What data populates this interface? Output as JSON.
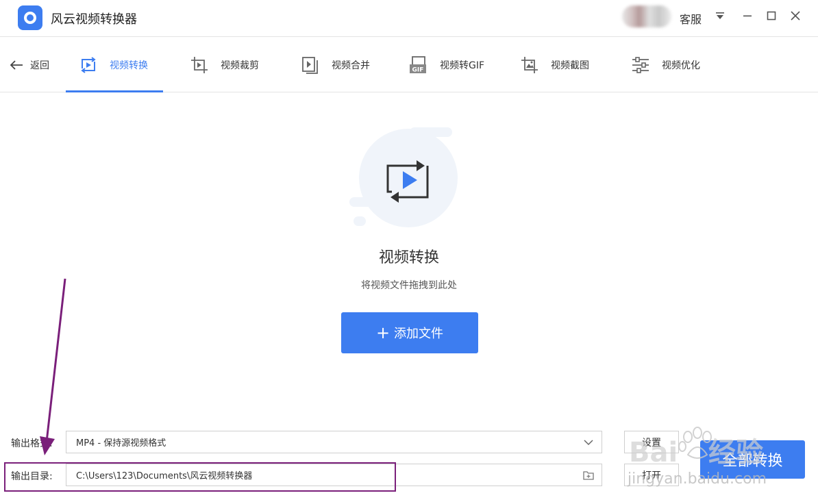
{
  "app": {
    "title": "风云视频转换器",
    "service_label": "客服"
  },
  "toolbar": {
    "back": "返回",
    "tabs": [
      {
        "label": "视频转换",
        "icon": "convert-icon",
        "active": true
      },
      {
        "label": "视频裁剪",
        "icon": "crop-icon",
        "active": false
      },
      {
        "label": "视频合并",
        "icon": "merge-icon",
        "active": false
      },
      {
        "label": "视频转GIF",
        "icon": "gif-icon",
        "active": false
      },
      {
        "label": "视频截图",
        "icon": "screenshot-icon",
        "active": false
      },
      {
        "label": "视频优化",
        "icon": "optimize-icon",
        "active": false
      }
    ]
  },
  "dropzone": {
    "title": "视频转换",
    "subtitle": "将视频文件拖拽到此处",
    "add_button": "添加文件",
    "add_button_prefix": "+"
  },
  "output": {
    "format_label": "输出格式:",
    "format_value": "MP4 - 保持源视频格式",
    "dir_label": "输出目录:",
    "dir_value": "C:\\Users\\123\\Documents\\风云视频转换器",
    "settings_button": "设置",
    "open_button": "打开",
    "convert_all_button": "全部转换"
  },
  "watermark": {
    "brand": "Baidu经验",
    "url": "jingyan.baidu.com"
  },
  "colors": {
    "accent": "#3d7df0",
    "annotation": "#7a1f7a"
  }
}
